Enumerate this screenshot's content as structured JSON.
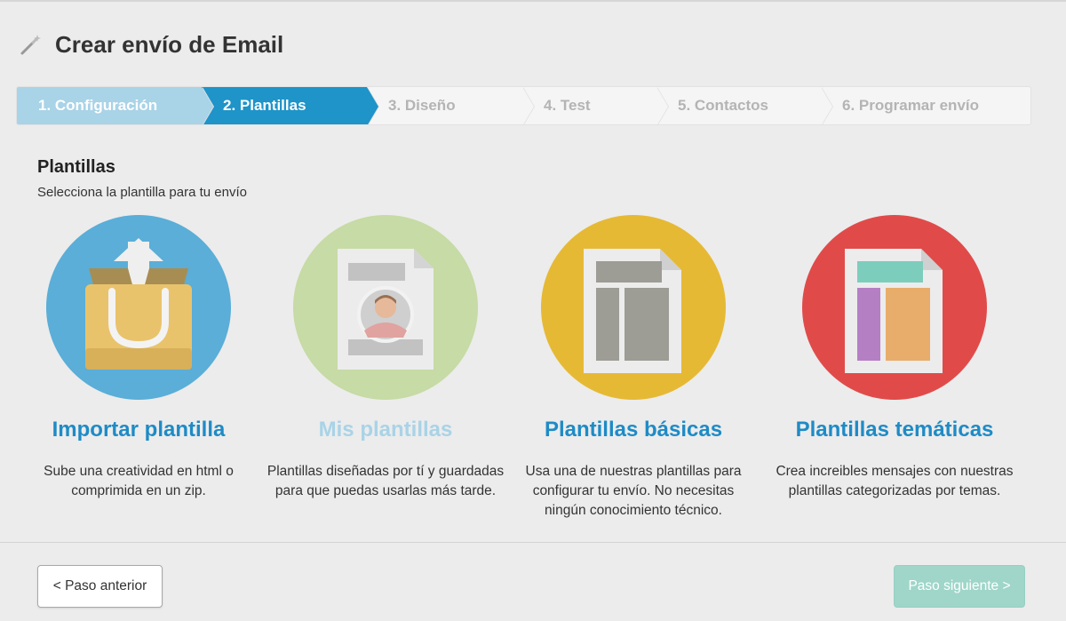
{
  "header": {
    "title": "Crear envío de Email",
    "icon": "magic-wand-icon"
  },
  "steps": [
    {
      "label": "1. Configuración",
      "state": "done"
    },
    {
      "label": "2. Plantillas",
      "state": "active"
    },
    {
      "label": "3. Diseño",
      "state": "pending"
    },
    {
      "label": "4. Test",
      "state": "pending"
    },
    {
      "label": "5. Contactos",
      "state": "pending"
    },
    {
      "label": "6. Programar envío",
      "state": "pending"
    }
  ],
  "section": {
    "title": "Plantillas",
    "subtitle": "Selecciona la plantilla para tu envío"
  },
  "cards": [
    {
      "title": "Importar plantilla",
      "description": "Sube una creatividad en html o comprimida en un zip.",
      "icon": "import-box-icon",
      "color": "#5aaed8",
      "enabled": true
    },
    {
      "title": "Mis plantillas",
      "description": "Plantillas diseñadas por tí y guardadas para que puedas usarlas más tarde.",
      "icon": "profile-document-icon",
      "color": "#c6dba5",
      "enabled": false
    },
    {
      "title": "Plantillas básicas",
      "description": "Usa una de nuestras plantillas para configurar tu envío. No necesitas ningún conocimiento técnico.",
      "icon": "basic-layout-icon",
      "color": "#e6b935",
      "enabled": true
    },
    {
      "title": "Plantillas temáticas",
      "description": "Crea increibles mensajes con nuestras plantillas categorizadas por temas.",
      "icon": "themed-layout-icon",
      "color": "#e04b4a",
      "enabled": true
    }
  ],
  "footer": {
    "prev_label": "< Paso anterior",
    "next_label": "Paso siguiente >"
  },
  "colors": {
    "accent": "#1e94c9",
    "done_step": "#a9d3e7",
    "next_button": "#9fd6c9"
  }
}
